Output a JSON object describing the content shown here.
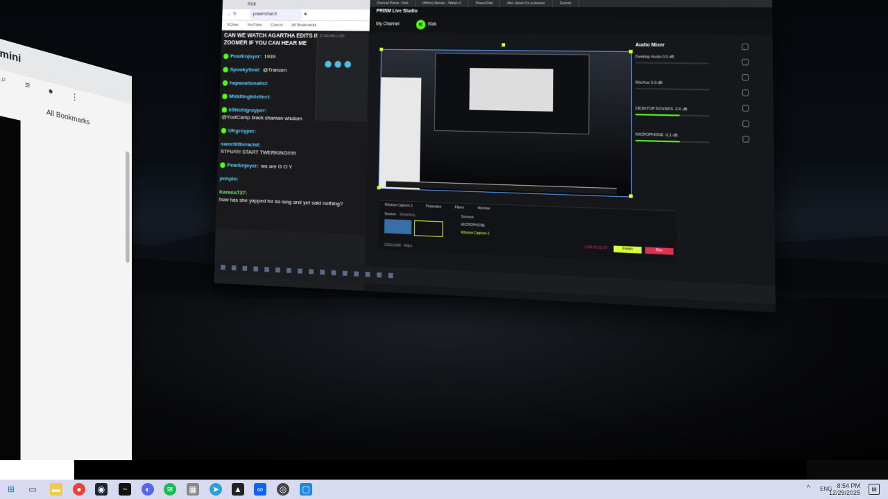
{
  "left_browser": {
    "tab_title": "mini",
    "bookmarks_label": "All Bookmarks"
  },
  "chrome": {
    "url": "powerchat.li",
    "bookmarks": [
      "XChan",
      "YouTube",
      "Cozy.tv",
      "All Bookmarks"
    ],
    "streams_label": "STREAMS 2,565"
  },
  "chat": {
    "header": "CAN WE WATCH AGARTHA EDITS IN ZOOMER IF YOU CAN HEAR ME",
    "messages": [
      {
        "user": "PearEnjoyer:",
        "text": "1939"
      },
      {
        "user": "SpookySeal:",
        "text": "@Trancen"
      },
      {
        "user": "hapanationalist:",
        "text": ""
      },
      {
        "user": "MiddlingIntellect:",
        "text": ""
      },
      {
        "user": "k0kichigroyper:",
        "text": "@YootCamp black shaman wisdom"
      },
      {
        "user": "UKgroyper:",
        "text": ""
      },
      {
        "user": "sweetlittleracist:",
        "text": "STFU!!!!! START TWERKING!!!!!!"
      },
      {
        "user": "PearEnjoyer:",
        "text": "we are G O Y"
      },
      {
        "user": "ponpio:",
        "text": ""
      },
      {
        "user": "KarasuT37:",
        "text": "how has she yapped for so long and yet said nothing?"
      }
    ]
  },
  "prism": {
    "tabs": [
      "Channel Points - Kick",
      "(Hrbzz) Stream - Watch Li",
      "PowerChat",
      "Alex Jones I'm a pioneer",
      "Gemini"
    ],
    "app_title": "PRISM Live Studio",
    "channel_label": "My Channel",
    "channel_name": "Kick",
    "mixer_title": "Audio Mixer",
    "mixer_channels": [
      {
        "name": "Desktop Audio",
        "level": "0.0 dB",
        "active": false
      },
      {
        "name": "Mic/Aux",
        "level": "0.0 dB",
        "active": false
      },
      {
        "name": "DESKTOP SOUNDS",
        "level": "-2.6 dB",
        "active": true
      },
      {
        "name": "MICROPHONE",
        "level": "-3.1 dB",
        "active": true
      }
    ],
    "source_title": "Window Capture 2",
    "dock_tabs": [
      "Properties",
      "Filters",
      "Window"
    ],
    "scenes_label": "Scenes",
    "scenes_mode": "Streaming",
    "sources_label": "Sources",
    "sources": [
      "MICROPHONE",
      "Window Capture 2"
    ],
    "live_timer": "LIVE 00:51:07",
    "golive_label": "Finish",
    "rec_label": "Rec",
    "resolution": "1920x1080 · 60fps"
  },
  "taskbar": {
    "lang": "ENG",
    "time": "8:54 PM",
    "date": "12/29/2025"
  }
}
